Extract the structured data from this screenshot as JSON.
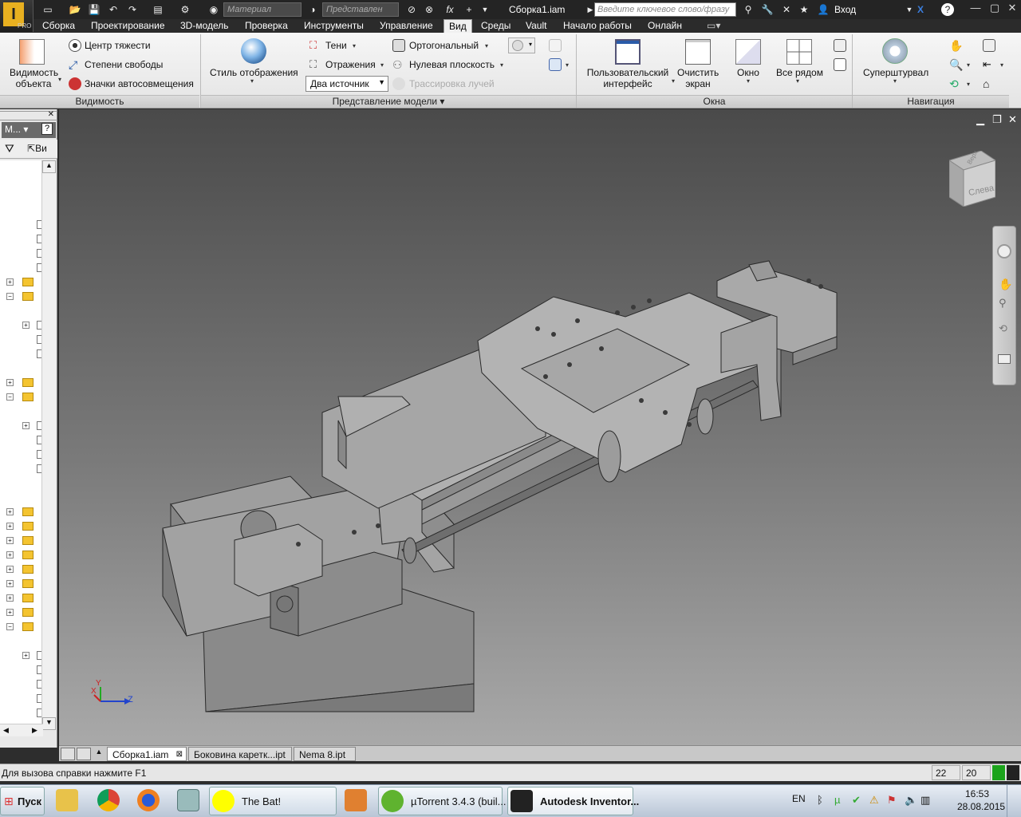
{
  "titlebar": {
    "document": "Сборка1.iam",
    "material_placeholder": "Материал",
    "appearance_placeholder": "Представлен",
    "search_placeholder": "Введите ключевое слово/фразу",
    "login": "Вход",
    "app_badge": "PRO"
  },
  "menu": {
    "tabs": [
      "Сборка",
      "Проектирование",
      "3D-модель",
      "Проверка",
      "Инструменты",
      "Управление",
      "Вид",
      "Среды",
      "Vault",
      "Начало работы",
      "Онлайн"
    ],
    "active": "Вид"
  },
  "ribbon": {
    "visibility": {
      "object_visibility": [
        "Видимость",
        "объекта"
      ],
      "center_of_gravity": "Центр тяжести",
      "dof": "Степени свободы",
      "auto_constraints": "Значки автосовмещения",
      "title": "Видимость"
    },
    "model_repr": {
      "display_style": "Стиль отображения",
      "shadows": "Тени",
      "reflections": "Отражения",
      "two_lights": "Два источник",
      "orthographic": "Ортогональный",
      "ground_plane": "Нулевая плоскость",
      "ray_tracing": "Трассировка лучей",
      "title": "Представление модели"
    },
    "windows": {
      "user_interface": [
        "Пользовательский",
        "интерфейс"
      ],
      "clean_screen": [
        "Очистить",
        "экран"
      ],
      "window": "Окно",
      "tile_all": "Все рядом",
      "title": "Окна"
    },
    "navigation": {
      "steering_wheel": "Суперштурвал",
      "title": "Навигация"
    }
  },
  "browser": {
    "header": "М...",
    "tool_label": "Ви"
  },
  "viewcube": {
    "face": "Слева",
    "top_face": "Верх"
  },
  "axis": {
    "y": "Y",
    "x": "X",
    "z": "Z"
  },
  "doctabs": [
    "Сборка1.iam",
    "Боковина каретк...ipt",
    "Nema 8.ipt"
  ],
  "status": {
    "help": "Для вызова справки нажмите F1",
    "n1": "22",
    "n2": "20"
  },
  "taskbar": {
    "start": "Пуск",
    "thebat": "The Bat!",
    "utorrent": "µTorrent 3.4.3  (buil...",
    "inventor": "Autodesk Inventor...",
    "lang": "EN",
    "time": "16:53",
    "date": "28.08.2015"
  }
}
